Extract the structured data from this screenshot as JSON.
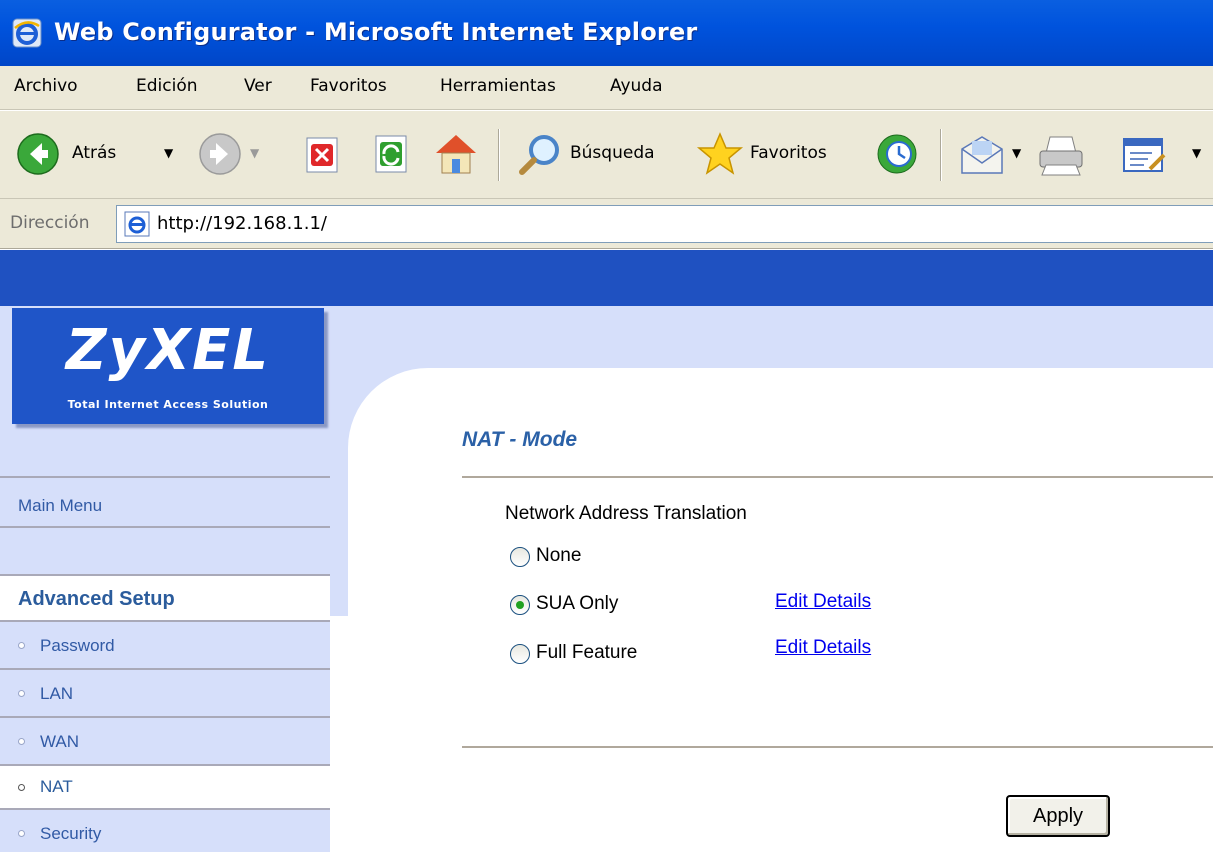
{
  "window": {
    "title": "Web Configurator - Microsoft Internet Explorer"
  },
  "menu": [
    "Archivo",
    "Edición",
    "Ver",
    "Favoritos",
    "Herramientas",
    "Ayuda"
  ],
  "toolbar": {
    "back_label": "Atrás",
    "search_label": "Búsqueda",
    "favorites_label": "Favoritos"
  },
  "address": {
    "label": "Dirección",
    "url": "http://192.168.1.1/"
  },
  "logo": {
    "brand": "ZyXEL",
    "tagline": "Total Internet Access Solution"
  },
  "sidebar": {
    "main_menu": "Main Menu",
    "advanced_setup": "Advanced Setup",
    "items": [
      "Password",
      "LAN",
      "WAN",
      "NAT",
      "Security"
    ],
    "selected": "NAT"
  },
  "main": {
    "title": "NAT - Mode",
    "section_label": "Network Address Translation",
    "options": [
      {
        "label": "None",
        "checked": false,
        "link": ""
      },
      {
        "label": "SUA Only",
        "checked": true,
        "link": "Edit Details"
      },
      {
        "label": "Full Feature",
        "checked": false,
        "link": "Edit Details"
      }
    ],
    "apply_label": "Apply"
  },
  "colors": {
    "titlebar": "#0053dd",
    "chrome": "#ece9d8",
    "page_blue": "#1f51c1",
    "panel_light": "#d6dffa",
    "heading": "#2b61a7",
    "link": "#0000ee"
  }
}
